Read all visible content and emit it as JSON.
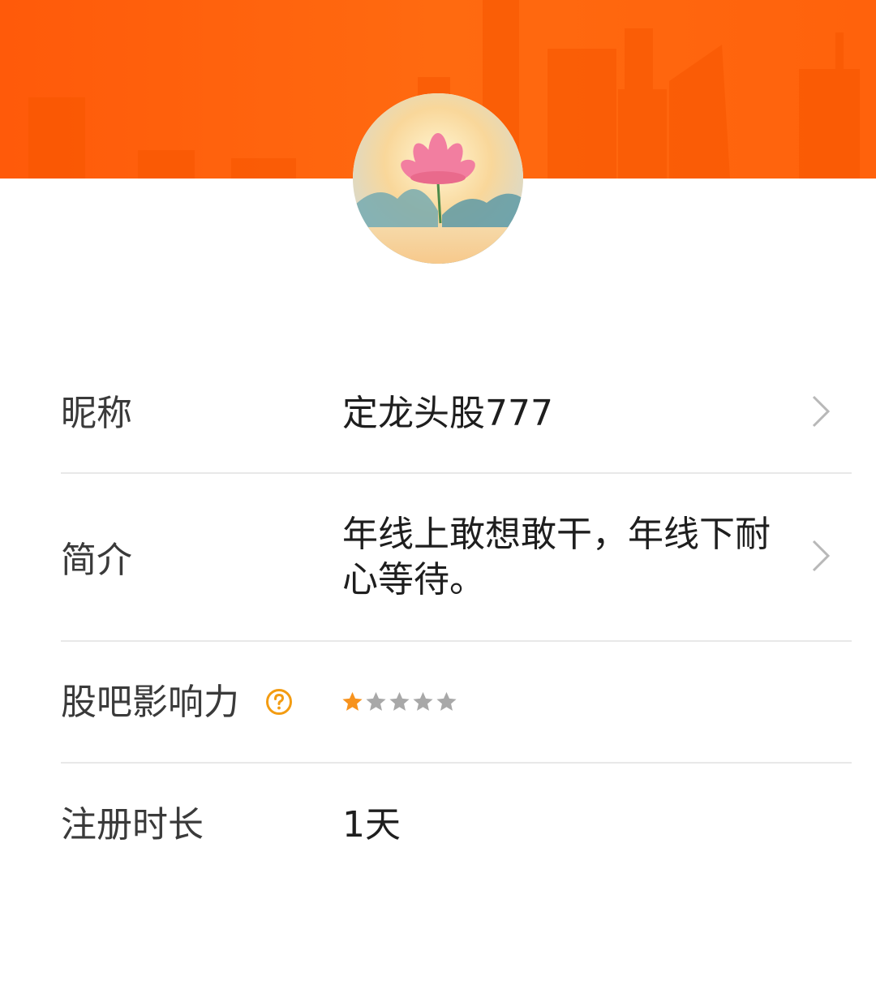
{
  "profile": {
    "nickname_label": "昵称",
    "nickname_value": "定龙头股777",
    "bio_label": "简介",
    "bio_value": "年线上敢想敢干，年线下耐心等待。",
    "influence_label": "股吧影响力",
    "influence_rating": 1,
    "influence_max": 5,
    "registration_label": "注册时长",
    "registration_value": "1天"
  },
  "icons": {
    "help": "question-circle-icon",
    "chevron": "chevron-right-icon",
    "star": "star-icon"
  },
  "colors": {
    "banner": "#ff6410",
    "accent": "#f39c12",
    "star_active": "#f7931e",
    "star_inactive": "#a8a8a8"
  }
}
